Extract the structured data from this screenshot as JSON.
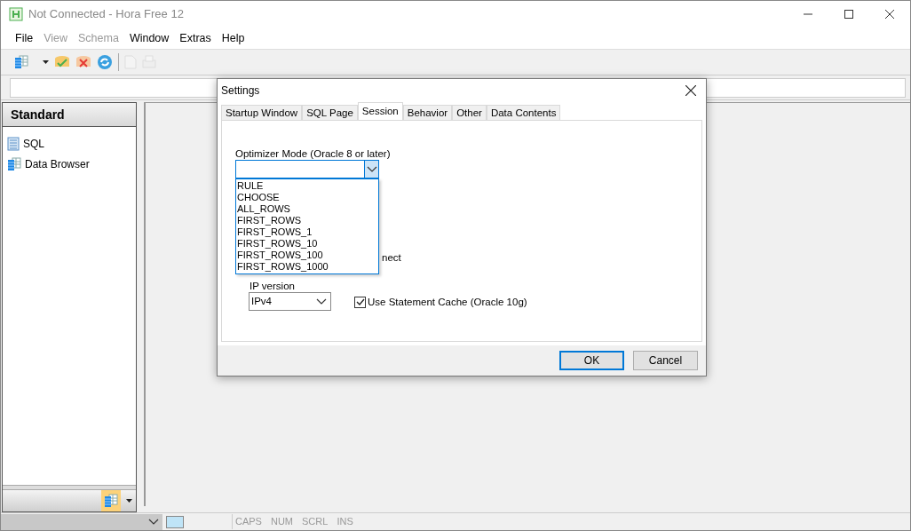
{
  "window": {
    "title": "Not Connected - Hora Free 12"
  },
  "menu": [
    {
      "label": "File",
      "disabled": false
    },
    {
      "label": "View",
      "disabled": true
    },
    {
      "label": "Schema",
      "disabled": true
    },
    {
      "label": "Window",
      "disabled": false
    },
    {
      "label": "Extras",
      "disabled": false
    },
    {
      "label": "Help",
      "disabled": false
    }
  ],
  "sidebar": {
    "title": "Standard",
    "items": [
      {
        "label": "SQL",
        "kind": "sql"
      },
      {
        "label": "Data Browser",
        "kind": "browser"
      }
    ]
  },
  "status_bar": {
    "indicators": [
      "CAPS",
      "NUM",
      "SCRL",
      "INS"
    ]
  },
  "dialog": {
    "title": "Settings",
    "tabs": [
      {
        "label": "Startup Window",
        "selected": false
      },
      {
        "label": "SQL Page",
        "selected": false
      },
      {
        "label": "Session",
        "selected": true
      },
      {
        "label": "Behavior",
        "selected": false
      },
      {
        "label": "Other",
        "selected": false
      },
      {
        "label": "Data Contents",
        "selected": false
      }
    ],
    "optimizer": {
      "label": "Optimizer Mode  (Oracle 8 or later)",
      "options": [
        "RULE",
        "CHOOSE",
        "ALL_ROWS",
        "FIRST_ROWS",
        "FIRST_ROWS_1",
        "FIRST_ROWS_10",
        "FIRST_ROWS_100",
        "FIRST_ROWS_1000"
      ]
    },
    "partial_label": "nect",
    "ip": {
      "label": "IP version",
      "value": "IPv4"
    },
    "statement_cache": {
      "label": "Use Statement Cache (Oracle 10g)",
      "checked": true
    },
    "buttons": [
      "OK",
      "Cancel"
    ]
  }
}
